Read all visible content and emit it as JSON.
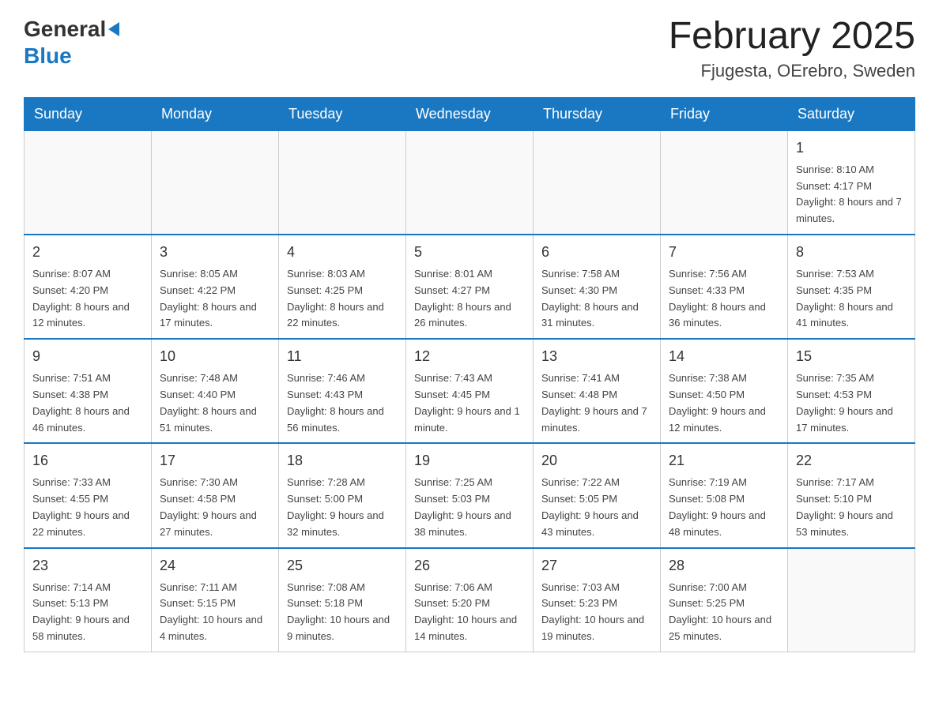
{
  "header": {
    "logo": {
      "line1": "General",
      "line2": "Blue"
    },
    "title": "February 2025",
    "location": "Fjugesta, OErebro, Sweden"
  },
  "weekdays": [
    "Sunday",
    "Monday",
    "Tuesday",
    "Wednesday",
    "Thursday",
    "Friday",
    "Saturday"
  ],
  "weeks": [
    [
      {
        "day": "",
        "info": ""
      },
      {
        "day": "",
        "info": ""
      },
      {
        "day": "",
        "info": ""
      },
      {
        "day": "",
        "info": ""
      },
      {
        "day": "",
        "info": ""
      },
      {
        "day": "",
        "info": ""
      },
      {
        "day": "1",
        "info": "Sunrise: 8:10 AM\nSunset: 4:17 PM\nDaylight: 8 hours and 7 minutes."
      }
    ],
    [
      {
        "day": "2",
        "info": "Sunrise: 8:07 AM\nSunset: 4:20 PM\nDaylight: 8 hours and 12 minutes."
      },
      {
        "day": "3",
        "info": "Sunrise: 8:05 AM\nSunset: 4:22 PM\nDaylight: 8 hours and 17 minutes."
      },
      {
        "day": "4",
        "info": "Sunrise: 8:03 AM\nSunset: 4:25 PM\nDaylight: 8 hours and 22 minutes."
      },
      {
        "day": "5",
        "info": "Sunrise: 8:01 AM\nSunset: 4:27 PM\nDaylight: 8 hours and 26 minutes."
      },
      {
        "day": "6",
        "info": "Sunrise: 7:58 AM\nSunset: 4:30 PM\nDaylight: 8 hours and 31 minutes."
      },
      {
        "day": "7",
        "info": "Sunrise: 7:56 AM\nSunset: 4:33 PM\nDaylight: 8 hours and 36 minutes."
      },
      {
        "day": "8",
        "info": "Sunrise: 7:53 AM\nSunset: 4:35 PM\nDaylight: 8 hours and 41 minutes."
      }
    ],
    [
      {
        "day": "9",
        "info": "Sunrise: 7:51 AM\nSunset: 4:38 PM\nDaylight: 8 hours and 46 minutes."
      },
      {
        "day": "10",
        "info": "Sunrise: 7:48 AM\nSunset: 4:40 PM\nDaylight: 8 hours and 51 minutes."
      },
      {
        "day": "11",
        "info": "Sunrise: 7:46 AM\nSunset: 4:43 PM\nDaylight: 8 hours and 56 minutes."
      },
      {
        "day": "12",
        "info": "Sunrise: 7:43 AM\nSunset: 4:45 PM\nDaylight: 9 hours and 1 minute."
      },
      {
        "day": "13",
        "info": "Sunrise: 7:41 AM\nSunset: 4:48 PM\nDaylight: 9 hours and 7 minutes."
      },
      {
        "day": "14",
        "info": "Sunrise: 7:38 AM\nSunset: 4:50 PM\nDaylight: 9 hours and 12 minutes."
      },
      {
        "day": "15",
        "info": "Sunrise: 7:35 AM\nSunset: 4:53 PM\nDaylight: 9 hours and 17 minutes."
      }
    ],
    [
      {
        "day": "16",
        "info": "Sunrise: 7:33 AM\nSunset: 4:55 PM\nDaylight: 9 hours and 22 minutes."
      },
      {
        "day": "17",
        "info": "Sunrise: 7:30 AM\nSunset: 4:58 PM\nDaylight: 9 hours and 27 minutes."
      },
      {
        "day": "18",
        "info": "Sunrise: 7:28 AM\nSunset: 5:00 PM\nDaylight: 9 hours and 32 minutes."
      },
      {
        "day": "19",
        "info": "Sunrise: 7:25 AM\nSunset: 5:03 PM\nDaylight: 9 hours and 38 minutes."
      },
      {
        "day": "20",
        "info": "Sunrise: 7:22 AM\nSunset: 5:05 PM\nDaylight: 9 hours and 43 minutes."
      },
      {
        "day": "21",
        "info": "Sunrise: 7:19 AM\nSunset: 5:08 PM\nDaylight: 9 hours and 48 minutes."
      },
      {
        "day": "22",
        "info": "Sunrise: 7:17 AM\nSunset: 5:10 PM\nDaylight: 9 hours and 53 minutes."
      }
    ],
    [
      {
        "day": "23",
        "info": "Sunrise: 7:14 AM\nSunset: 5:13 PM\nDaylight: 9 hours and 58 minutes."
      },
      {
        "day": "24",
        "info": "Sunrise: 7:11 AM\nSunset: 5:15 PM\nDaylight: 10 hours and 4 minutes."
      },
      {
        "day": "25",
        "info": "Sunrise: 7:08 AM\nSunset: 5:18 PM\nDaylight: 10 hours and 9 minutes."
      },
      {
        "day": "26",
        "info": "Sunrise: 7:06 AM\nSunset: 5:20 PM\nDaylight: 10 hours and 14 minutes."
      },
      {
        "day": "27",
        "info": "Sunrise: 7:03 AM\nSunset: 5:23 PM\nDaylight: 10 hours and 19 minutes."
      },
      {
        "day": "28",
        "info": "Sunrise: 7:00 AM\nSunset: 5:25 PM\nDaylight: 10 hours and 25 minutes."
      },
      {
        "day": "",
        "info": ""
      }
    ]
  ]
}
